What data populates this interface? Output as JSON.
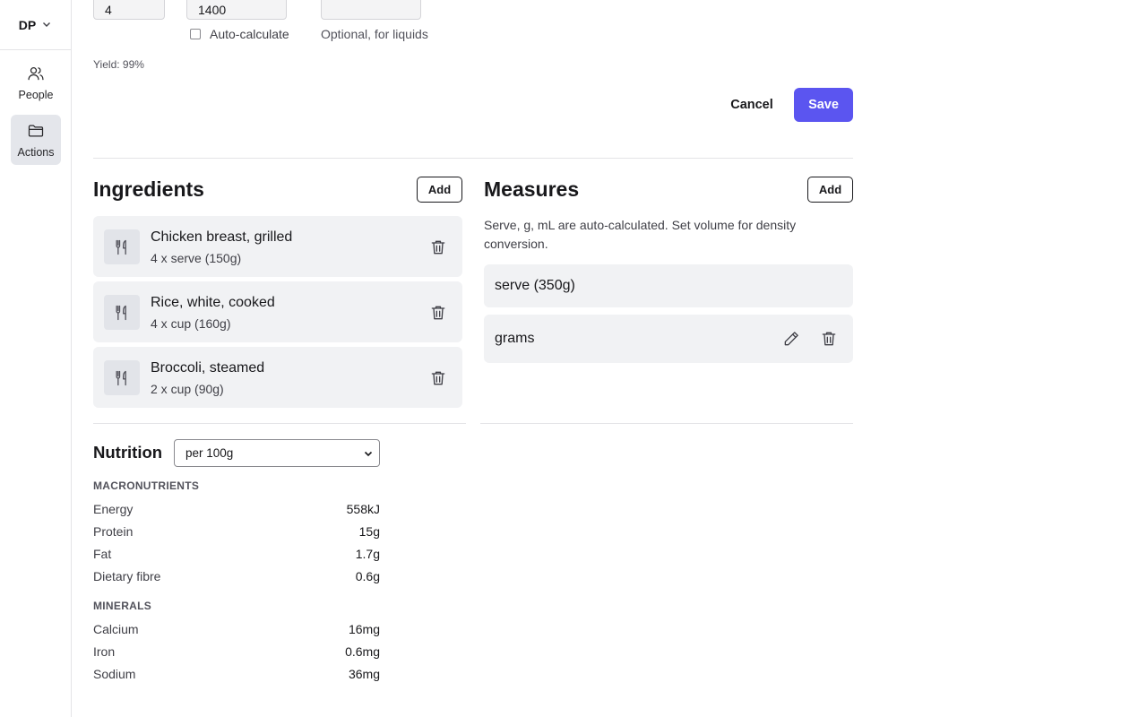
{
  "sidebar": {
    "user_initials": "DP",
    "items": [
      {
        "label": "People",
        "icon": "people-icon"
      },
      {
        "label": "Actions",
        "icon": "folder-icon",
        "active": true
      }
    ]
  },
  "form": {
    "servings_value": "4",
    "weight_value": "1400",
    "volume_value": "",
    "auto_calculate_label": "Auto-calculate",
    "auto_calculate_checked": false,
    "volume_hint": "Optional, for liquids",
    "yield": "Yield: 99%",
    "cancel_label": "Cancel",
    "save_label": "Save"
  },
  "ingredients": {
    "title": "Ingredients",
    "add_label": "Add",
    "items": [
      {
        "name": "Chicken breast, grilled",
        "qty": "4 x serve (150g)"
      },
      {
        "name": "Rice, white, cooked",
        "qty": "4 x cup (160g)"
      },
      {
        "name": "Broccoli, steamed",
        "qty": "2 x cup (90g)"
      }
    ]
  },
  "measures": {
    "title": "Measures",
    "add_label": "Add",
    "description": "Serve, g, mL are auto-calculated. Set volume for density conversion.",
    "items": [
      {
        "label": "serve (350g)",
        "editable": false
      },
      {
        "label": "grams",
        "editable": true
      }
    ]
  },
  "nutrition": {
    "title": "Nutrition",
    "basis": "per 100g",
    "groups": [
      {
        "name": "MACRONUTRIENTS",
        "rows": [
          {
            "label": "Energy",
            "value": "558kJ"
          },
          {
            "label": "Protein",
            "value": "15g"
          },
          {
            "label": "Fat",
            "value": "1.7g"
          },
          {
            "label": "Dietary fibre",
            "value": "0.6g"
          }
        ]
      },
      {
        "name": "MINERALS",
        "rows": [
          {
            "label": "Calcium",
            "value": "16mg"
          },
          {
            "label": "Iron",
            "value": "0.6mg"
          },
          {
            "label": "Sodium",
            "value": "36mg"
          }
        ]
      }
    ]
  },
  "colors": {
    "accent": "#5b55f0",
    "card_bg": "#f1f2f4",
    "nav_active_bg": "#e4e6eb"
  }
}
